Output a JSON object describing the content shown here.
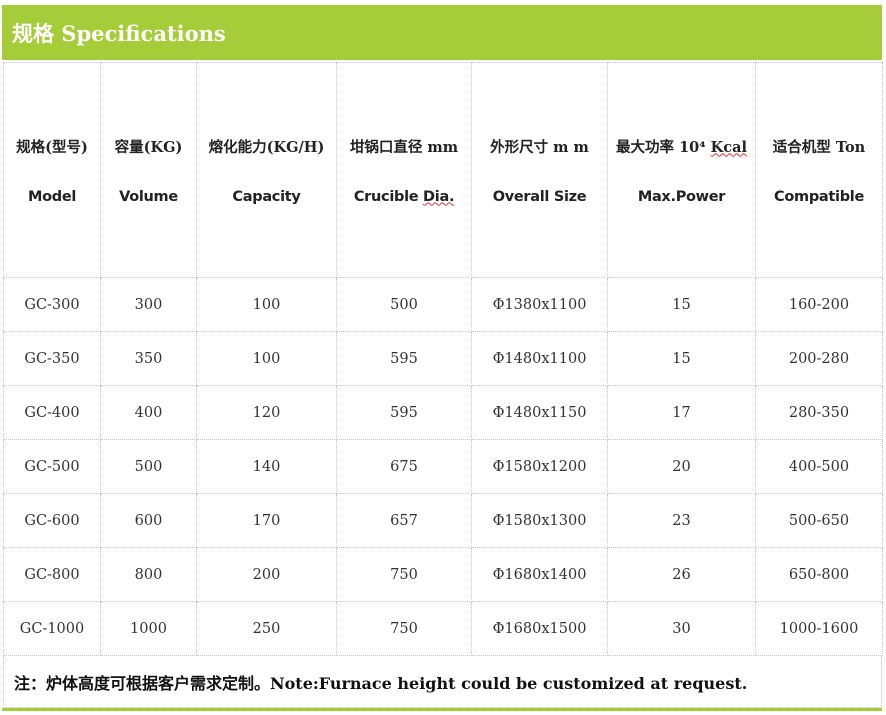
{
  "title": "规格 Specifications",
  "headers": [
    {
      "zh": "规格(型号)",
      "en": "Model"
    },
    {
      "zh": "容量(KG)",
      "en": "Volume"
    },
    {
      "zh": "熔化能力(KG/H)",
      "en": "Capacity"
    },
    {
      "zh": "坩锅口直径 mm",
      "en_a": "Crucible ",
      "en_b": "Dia."
    },
    {
      "zh": "外形尺寸 m m",
      "en": "Overall Size"
    },
    {
      "zh_a": "最大功率 10⁴  ",
      "zh_b": "Kcal",
      "en": "Max.Power"
    },
    {
      "zh": "适合机型 Ton",
      "en": "Compatible"
    }
  ],
  "rows": [
    [
      "GC-300",
      "300",
      "100",
      "500",
      "Φ1380x1100",
      "15",
      "160-200"
    ],
    [
      "GC-350",
      "350",
      "100",
      "595",
      "Φ1480x1100",
      "15",
      "200-280"
    ],
    [
      "GC-400",
      "400",
      "120",
      "595",
      "Φ1480x1150",
      "17",
      "280-350"
    ],
    [
      "GC-500",
      "500",
      "140",
      "675",
      "Φ1580x1200",
      "20",
      "400-500"
    ],
    [
      "GC-600",
      "600",
      "170",
      "657",
      "Φ1580x1300",
      "23",
      "500-650"
    ],
    [
      "GC-800",
      "800",
      "200",
      "750",
      "Φ1680x1400",
      "26",
      "650-800"
    ],
    [
      "GC-1000",
      "1000",
      "250",
      "750",
      "Φ1680x1500",
      "30",
      "1000-1600"
    ]
  ],
  "note": "注：炉体高度可根据客户需求定制。Note:Furnace height could be customized at request.",
  "colors": {
    "accent": "#a4cd39"
  }
}
